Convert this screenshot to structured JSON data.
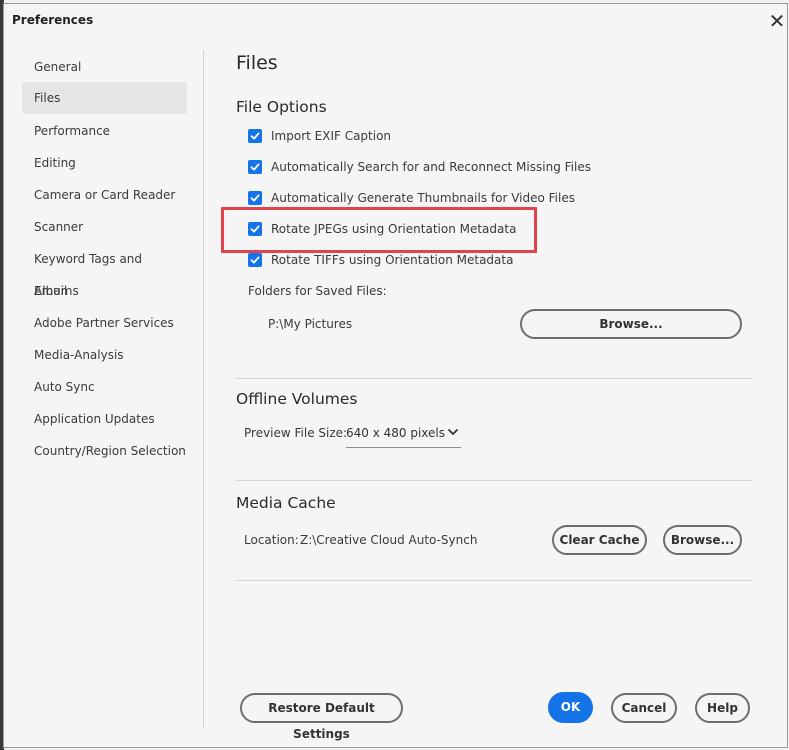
{
  "window": {
    "title": "Preferences"
  },
  "sidebar": {
    "items": [
      {
        "label": "General"
      },
      {
        "label": "Files"
      },
      {
        "label": "Performance"
      },
      {
        "label": "Editing"
      },
      {
        "label": "Camera or Card Reader"
      },
      {
        "label": "Scanner"
      },
      {
        "label": "Keyword Tags and Albums"
      },
      {
        "label": "Email"
      },
      {
        "label": "Adobe Partner Services"
      },
      {
        "label": "Media-Analysis"
      },
      {
        "label": "Auto Sync"
      },
      {
        "label": "Application Updates"
      },
      {
        "label": "Country/Region Selection"
      }
    ],
    "active": "Files"
  },
  "page": {
    "title": "Files"
  },
  "file_options": {
    "heading": "File Options",
    "checkboxes": [
      {
        "label": "Import EXIF Caption",
        "checked": true
      },
      {
        "label": "Automatically Search for and Reconnect Missing Files",
        "checked": true
      },
      {
        "label": "Automatically Generate Thumbnails for Video Files",
        "checked": true
      },
      {
        "label": "Rotate JPEGs using Orientation Metadata",
        "checked": true
      },
      {
        "label": "Rotate TIFFs using Orientation Metadata",
        "checked": true
      }
    ],
    "folders_label": "Folders for Saved Files:",
    "folder_path": "P:\\My Pictures",
    "browse_label": "Browse..."
  },
  "offline_volumes": {
    "heading": "Offline Volumes",
    "preview_label": "Preview File Size:",
    "preview_value": "640 x 480 pixels"
  },
  "media_cache": {
    "heading": "Media Cache",
    "location_label": "Location:",
    "location_value": "Z:\\Creative Cloud Auto-Synch",
    "clear_label": "Clear Cache",
    "browse_label": "Browse..."
  },
  "footer": {
    "restore_label": "Restore Default Settings",
    "ok_label": "OK",
    "cancel_label": "Cancel",
    "help_label": "Help"
  },
  "colors": {
    "accent": "#1473e6",
    "highlight": "#e0454d"
  }
}
